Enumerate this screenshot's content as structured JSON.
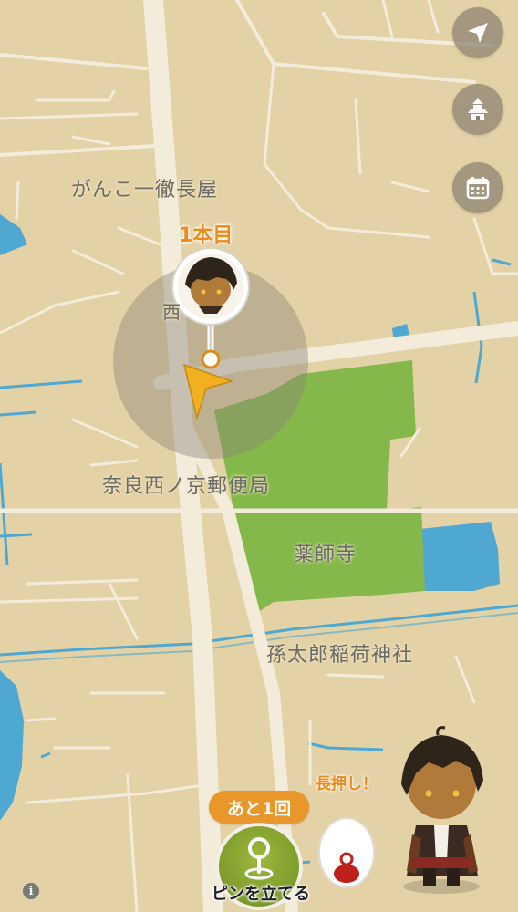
{
  "map": {
    "labels": {
      "gankoichi": "がんこ一徹長屋",
      "post_office": "奈良西ノ京郵便局",
      "yakushiji": "薬師寺",
      "magotaro": "孫太郎稲荷神社",
      "partial": "西"
    }
  },
  "pin": {
    "label": "1本目"
  },
  "controls": {
    "location_icon": "location-arrow-icon",
    "castle_icon": "castle-icon",
    "calendar_icon": "calendar-icon",
    "info_icon": "info-icon",
    "info_text": "i"
  },
  "bottom": {
    "remaining": "あと1回",
    "place_pin": "ピンを立てる",
    "hint": "長押し！"
  },
  "colors": {
    "land": "#e3d2a6",
    "road": "#f3ecda",
    "water": "#4fa8d2",
    "park": "#85b84a",
    "accent": "#f08a1a",
    "button_green": "#85a030"
  }
}
